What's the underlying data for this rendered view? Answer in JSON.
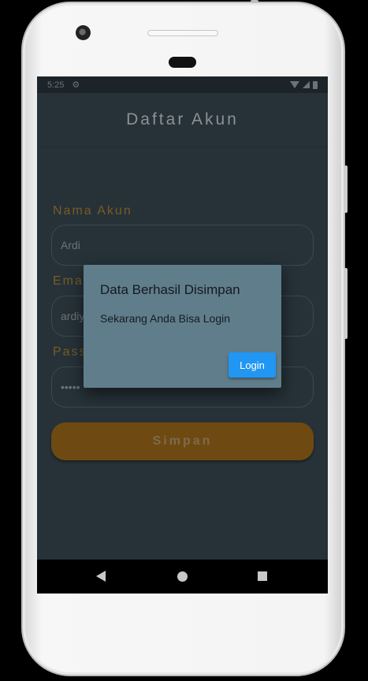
{
  "status_bar": {
    "time": "5:25",
    "icons": [
      "gear-icon",
      "wifi-icon",
      "signal-icon",
      "battery-icon"
    ]
  },
  "app_bar": {
    "title": "Daftar Akun"
  },
  "form": {
    "name_label": "Nama Akun",
    "name_value": "Ardi",
    "email_label": "Email",
    "email_value": "ardiy",
    "password_label": "Password",
    "password_value": "•••••",
    "save_label": "Simpan"
  },
  "dialog": {
    "title": "Data Berhasil Disimpan",
    "message": "Sekarang Anda Bisa Login",
    "login_label": "Login"
  },
  "nav_bar": {
    "icons": [
      "back-icon",
      "home-icon",
      "recent-apps-icon"
    ]
  },
  "colors": {
    "screen_bg": "#263238",
    "dialog_bg": "#607d8b",
    "accent_button": "#2196f3",
    "save_button": "#6e4a12"
  }
}
